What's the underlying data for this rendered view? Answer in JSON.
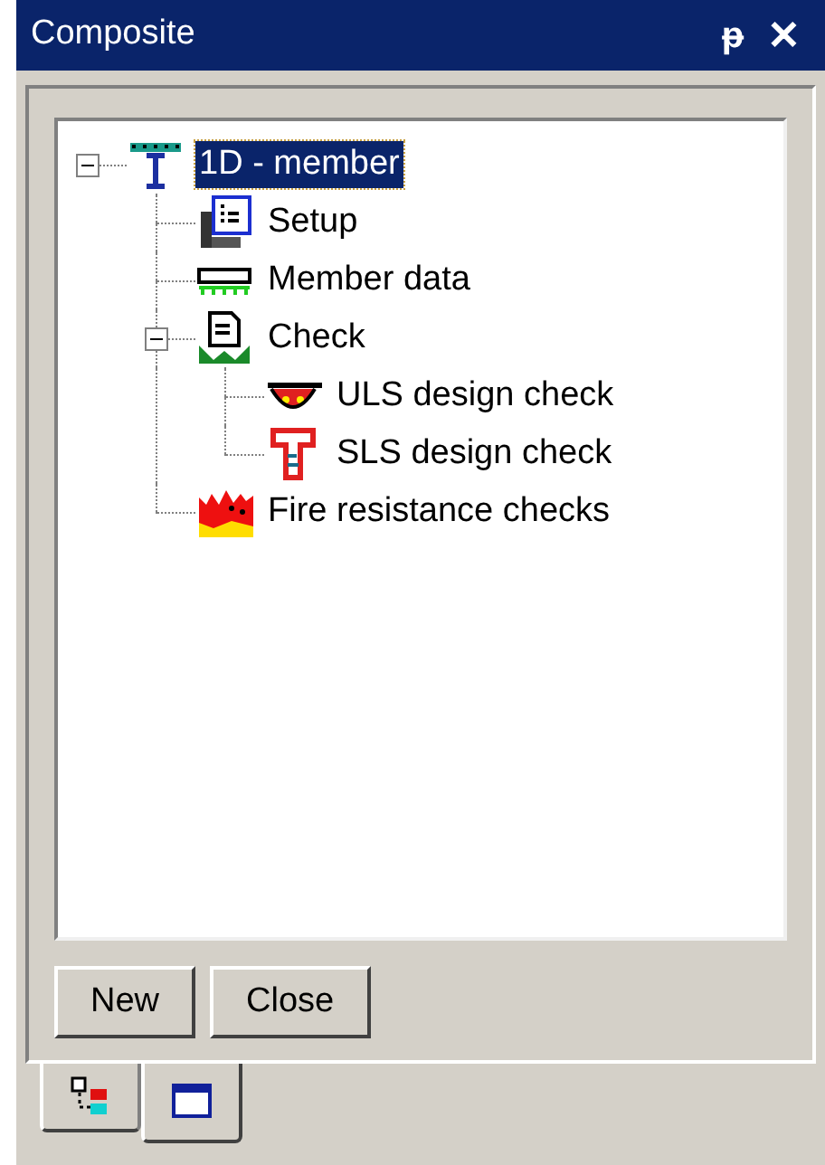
{
  "window": {
    "title": "Composite",
    "buttons": [
      "ᵽ",
      "✕"
    ]
  },
  "tree": [
    {
      "label": "1D - member",
      "kind": "member",
      "selected": true,
      "expanded": true,
      "children": [
        {
          "label": "Setup",
          "kind": "setup",
          "selected": false
        },
        {
          "label": "Member data",
          "kind": "member-data",
          "selected": false
        },
        {
          "label": "Check",
          "kind": "check",
          "selected": false,
          "expanded": true,
          "children": [
            {
              "label": "ULS design check",
              "kind": "uls",
              "selected": false
            },
            {
              "label": "SLS design check",
              "kind": "sls",
              "selected": false
            }
          ]
        },
        {
          "label": "Fire resistance checks",
          "kind": "fire",
          "selected": false
        }
      ]
    }
  ],
  "buttons": [
    "New",
    "Close"
  ],
  "tabs": [
    {
      "kind": "tree",
      "selected": false
    },
    {
      "kind": "window",
      "selected": true
    }
  ]
}
